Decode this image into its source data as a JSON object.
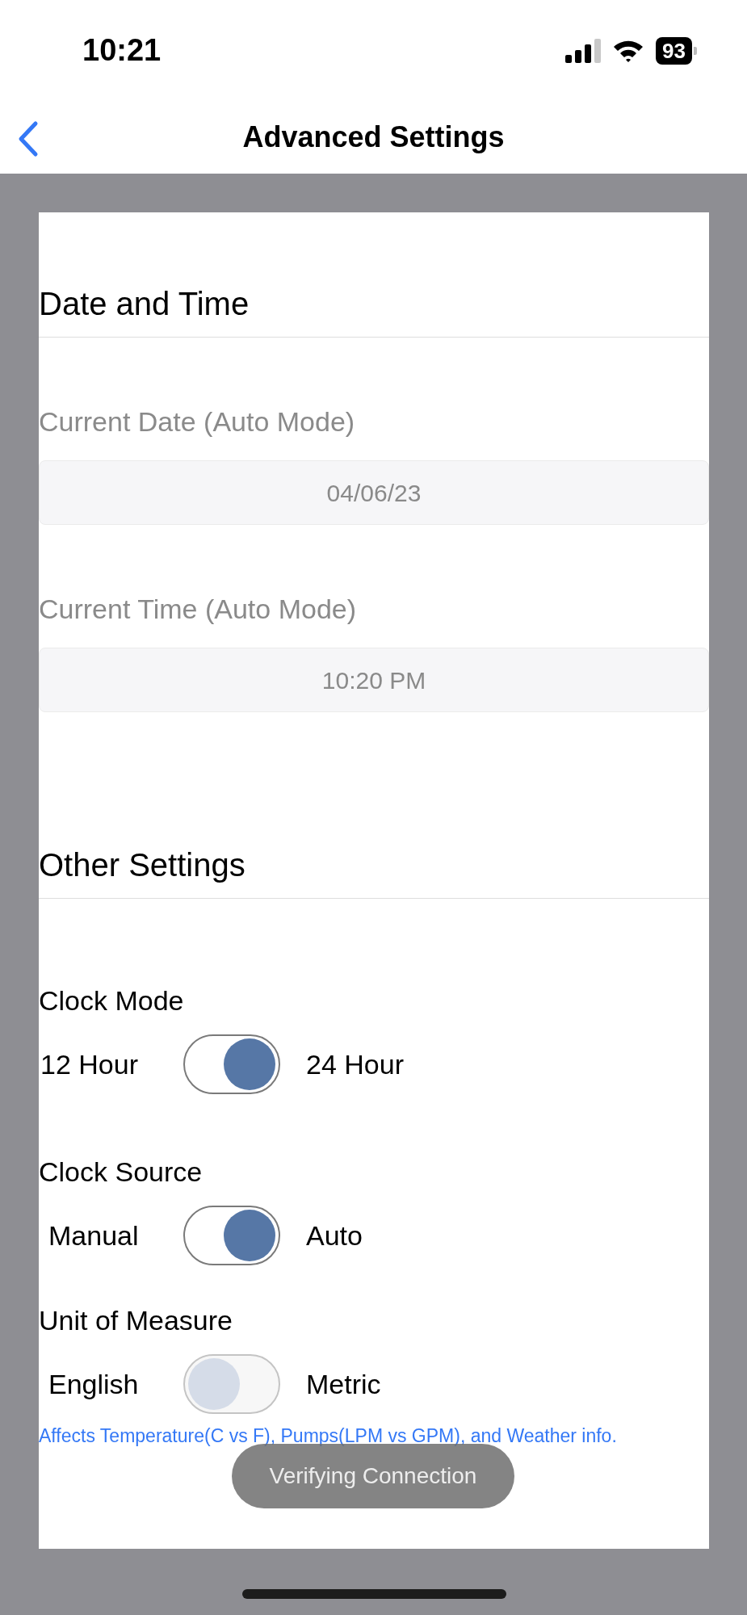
{
  "status_bar": {
    "time": "10:21",
    "battery": "93"
  },
  "nav": {
    "title": "Advanced Settings"
  },
  "date_time": {
    "heading": "Date and Time",
    "fields": [
      {
        "label": "Current Date (Auto Mode)",
        "value": "04/06/23"
      },
      {
        "label": "Current Time (Auto Mode)",
        "value": "10:20 PM"
      }
    ]
  },
  "other_settings": {
    "heading": "Other Settings",
    "toggles": [
      {
        "title": "Clock Mode",
        "off_label": "12 Hour",
        "on_label": "24 Hour",
        "on": true
      },
      {
        "title": "Clock Source",
        "off_label": "Manual",
        "on_label": "Auto",
        "on": true
      },
      {
        "title": "Unit of Measure",
        "off_label": "English",
        "on_label": "Metric",
        "on": false
      }
    ],
    "note": "Affects Temperature(C vs F), Pumps(LPM vs GPM), and Weather info."
  },
  "toast": "Verifying Connection"
}
